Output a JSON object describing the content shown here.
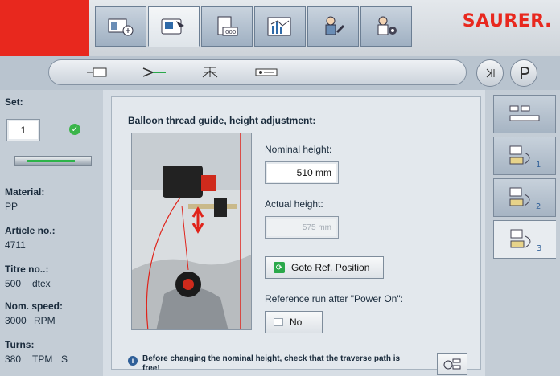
{
  "brand": {
    "logo_text": "SAURER.",
    "accent": "#e8281e"
  },
  "top_tabs": [
    {
      "icon": "machine-overview-icon"
    },
    {
      "icon": "monitor-settings-icon"
    },
    {
      "icon": "counter-icon"
    },
    {
      "icon": "production-chart-icon"
    },
    {
      "icon": "service-tools-icon"
    },
    {
      "icon": "user-settings-icon"
    }
  ],
  "subnav": [
    {
      "icon": "bobbin-icon"
    },
    {
      "icon": "thread-guide-icon"
    },
    {
      "icon": "frame-icon"
    },
    {
      "icon": "traverse-icon"
    }
  ],
  "left": {
    "set_label": "Set:",
    "set_value": "1",
    "material_label": "Material:",
    "material_value": "PP",
    "article_label": "Article no.:",
    "article_value": "4711",
    "titre_label": "Titre no..:",
    "titre_value": "500",
    "titre_unit": "dtex",
    "speed_label": "Nom. speed:",
    "speed_value": "3000",
    "speed_unit": "RPM",
    "turns_label": "Turns:",
    "turns_value": "380",
    "turns_unit": "TPM",
    "turns_dir": "S"
  },
  "main": {
    "heading": "Balloon thread guide, height adjustment:",
    "nominal_label": "Nominal height:",
    "nominal_value": "510 mm",
    "actual_label": "Actual height:",
    "actual_value": "575 mm",
    "goto_label": "Goto Ref. Position",
    "refrun_label": "Reference run after \"Power On\":",
    "refrun_value": "No",
    "info_text": "Before changing the nominal height, check that the traverse path is free!"
  },
  "right_tabs": [
    {
      "icon": "overview-grid-icon",
      "sub": ""
    },
    {
      "icon": "balloon-guide-1-icon",
      "sub": "1"
    },
    {
      "icon": "balloon-guide-2-icon",
      "sub": "2"
    },
    {
      "icon": "balloon-guide-3-icon",
      "sub": "3"
    }
  ]
}
